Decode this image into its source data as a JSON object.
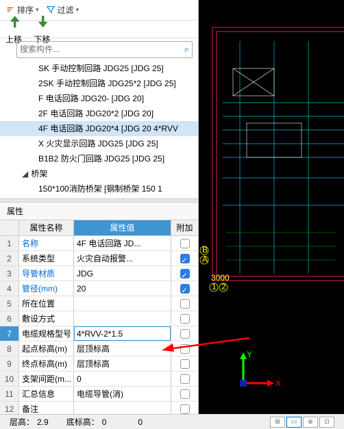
{
  "toolbar": {
    "sort": "排序",
    "filter": "过滤",
    "up": "上移",
    "down": "下移"
  },
  "search": {
    "placeholder": "搜索构件..."
  },
  "tree": {
    "items": [
      "SK 手动控制回路 JDG25 [JDG 25]",
      "2SK 手动控制回路 JDG25*2 [JDG 25]",
      "F 电话回路 JDG20- [JDG 20]",
      "2F 电话回路 JDG20*2 [JDG 20]",
      "4F 电话回路 JDG20*4 [JDG 20 4*RVV",
      "X 火灾显示回路 JDG25 [JDG 25]",
      "B1B2 防火门回路 JDG25 [JDG 25]"
    ],
    "selected_index": 4,
    "group_label": "桥架",
    "sub_item": "150*100消防桥架 [钢制桥架 150 1"
  },
  "props": {
    "title": "属性",
    "header": {
      "name": "属性名称",
      "value": "属性值",
      "extra": "附加"
    },
    "rows": [
      {
        "n": "1",
        "k": "名称",
        "v": "4F 电话回路 JD...",
        "chk": false,
        "blue": true
      },
      {
        "n": "2",
        "k": "系统类型",
        "v": "火灾自动报警...",
        "chk": true,
        "blue": false
      },
      {
        "n": "3",
        "k": "导管材质",
        "v": "JDG",
        "chk": true,
        "blue": true
      },
      {
        "n": "4",
        "k": "管径(mm)",
        "v": "20",
        "chk": true,
        "blue": true
      },
      {
        "n": "5",
        "k": "所在位置",
        "v": "",
        "chk": false,
        "blue": false
      },
      {
        "n": "6",
        "k": "敷设方式",
        "v": "",
        "chk": false,
        "blue": false
      },
      {
        "n": "7",
        "k": "电缆规格型号",
        "v": "4*RVV-2*1.5",
        "chk": false,
        "blue": false,
        "sel": true
      },
      {
        "n": "8",
        "k": "起点标高(m)",
        "v": "层顶标高",
        "chk": false,
        "blue": false
      },
      {
        "n": "9",
        "k": "终点标高(m)",
        "v": "层顶标高",
        "chk": false,
        "blue": false
      },
      {
        "n": "10",
        "k": "支架间距(m...",
        "v": "0",
        "chk": false,
        "blue": false
      },
      {
        "n": "11",
        "k": "汇总信息",
        "v": "电缆导管(消)",
        "chk": false,
        "blue": false
      },
      {
        "n": "12",
        "k": "备注",
        "v": "",
        "chk": false,
        "blue": false
      }
    ]
  },
  "status": {
    "floor_label": "层高：",
    "floor_value": "2.9",
    "bottom_label": "底标高：",
    "bottom_value": "0",
    "zero": "0"
  },
  "canvas": {
    "dim1": "3000",
    "dim2": "3000",
    "col_label": "B A",
    "num_label": "1 2",
    "axis_x": "X",
    "axis_y": "Y"
  }
}
